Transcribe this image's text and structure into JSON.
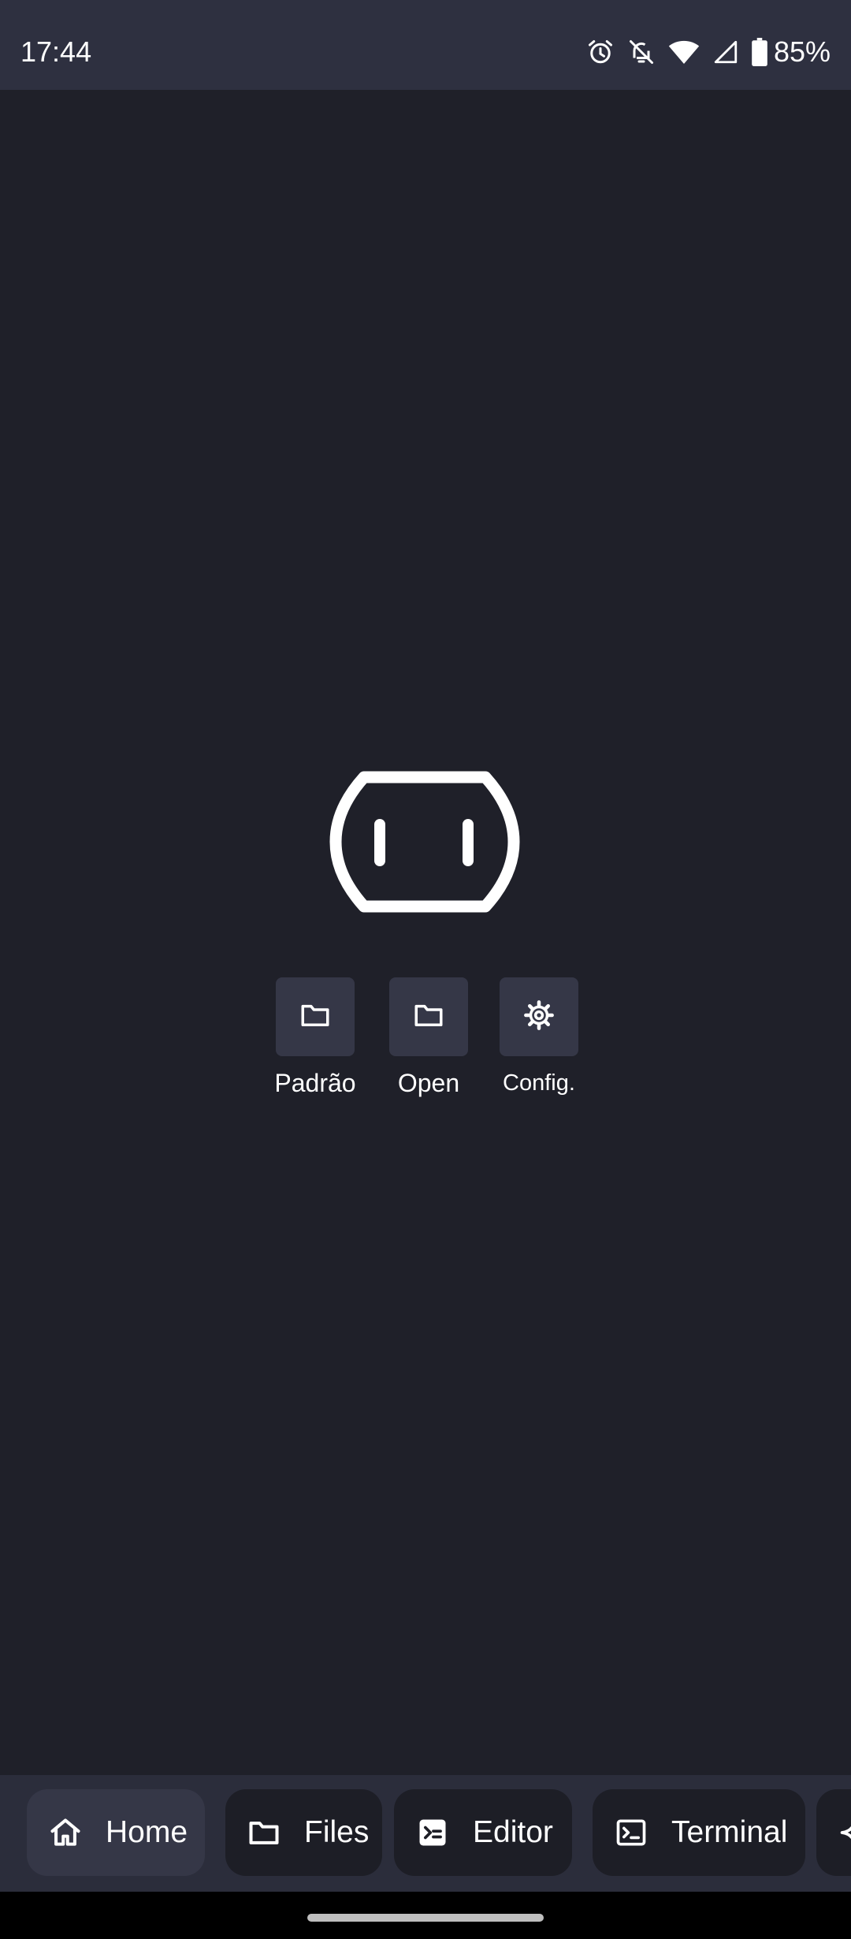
{
  "status_bar": {
    "time": "17:44",
    "battery_percent": "85%",
    "icons": [
      "alarm-icon",
      "notifications-off-icon",
      "wifi-icon",
      "cellular-signal-icon",
      "battery-icon"
    ]
  },
  "quick_actions": [
    {
      "label": "Padrão",
      "icon": "folder-icon"
    },
    {
      "label": "Open",
      "icon": "folder-icon"
    },
    {
      "label": "Config.",
      "icon": "gear-icon"
    }
  ],
  "bottom_nav": {
    "tabs": [
      {
        "label": "Home",
        "icon": "home-icon",
        "active": true
      },
      {
        "label": "Files",
        "icon": "folder-icon",
        "active": false
      },
      {
        "label": "Editor",
        "icon": "editor-icon",
        "active": false
      },
      {
        "label": "Terminal",
        "icon": "terminal-icon",
        "active": false
      },
      {
        "label": "",
        "icon": "sparkle-icon",
        "active": false
      }
    ]
  },
  "colors": {
    "background": "#1f2029",
    "status_bar": "#2e3040",
    "nav_bar": "#2b2d3b",
    "tab": "#1d1e26",
    "tab_active": "#353747",
    "accent_text": "#ffffff"
  }
}
